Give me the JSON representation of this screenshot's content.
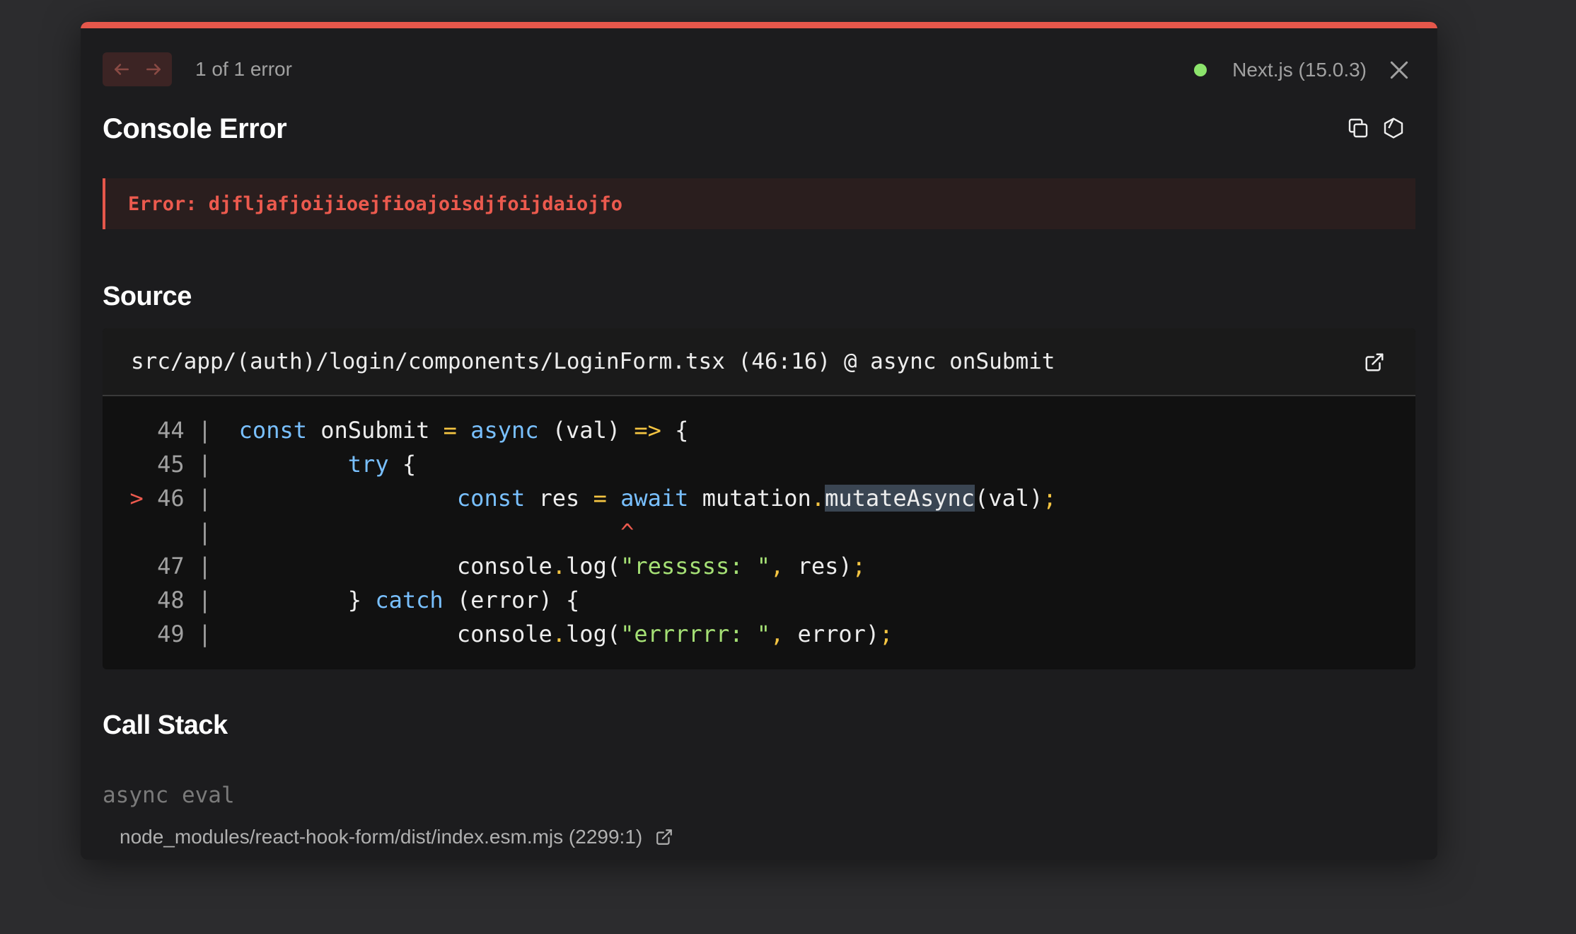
{
  "header": {
    "error_count": "1 of 1 error",
    "version": "Next.js (15.0.3)"
  },
  "title": "Console Error",
  "error": {
    "message": "Error: djfljafjoijioejfioajoisdjfoijdaiojfo"
  },
  "source": {
    "heading": "Source",
    "file": "src/app/(auth)/login/components/LoginForm.tsx (46:16) @ async onSubmit"
  },
  "call_stack": {
    "heading": "Call Stack",
    "function": "async eval",
    "file": "node_modules/react-hook-form/dist/index.esm.mjs (2299:1)"
  },
  "colors": {
    "accent_red": "#e5574b",
    "status_green": "#8ce46c",
    "keyword_blue": "#79c0ff",
    "string_green": "#a5e075",
    "operator_yellow": "#f5c542"
  }
}
